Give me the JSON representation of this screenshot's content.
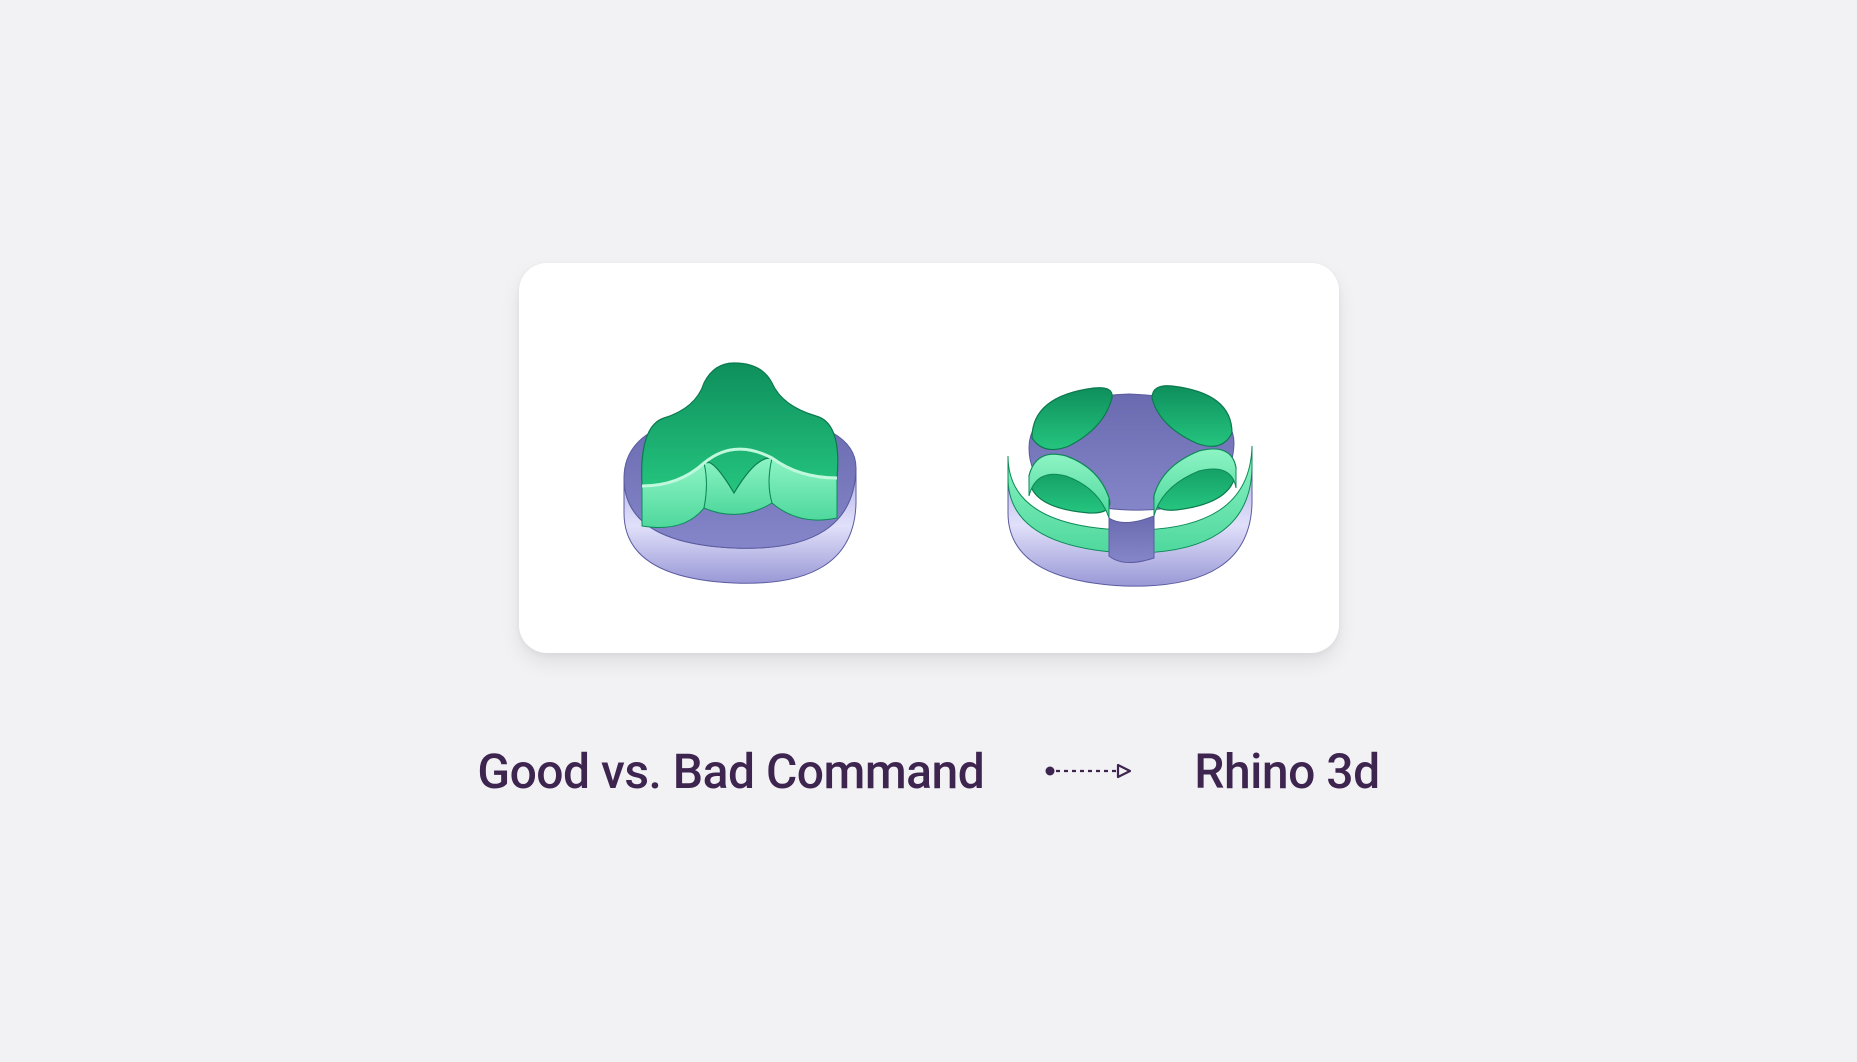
{
  "caption": {
    "left": "Good vs. Bad Command",
    "right": "Rhino 3d"
  },
  "colors": {
    "text": "#3e2550",
    "panel": "#ffffff",
    "bg": "#f2f2f4",
    "green_top": "#10a36a",
    "green_mid": "#2ecf88",
    "green_light": "#9ff0c8",
    "purple_top": "#6f6fb3",
    "purple_mid": "#a7a6e2",
    "purple_light": "#d6d6f6"
  },
  "diagram": {
    "left": "boolean-intersection-good",
    "right": "boolean-intersection-bad"
  }
}
